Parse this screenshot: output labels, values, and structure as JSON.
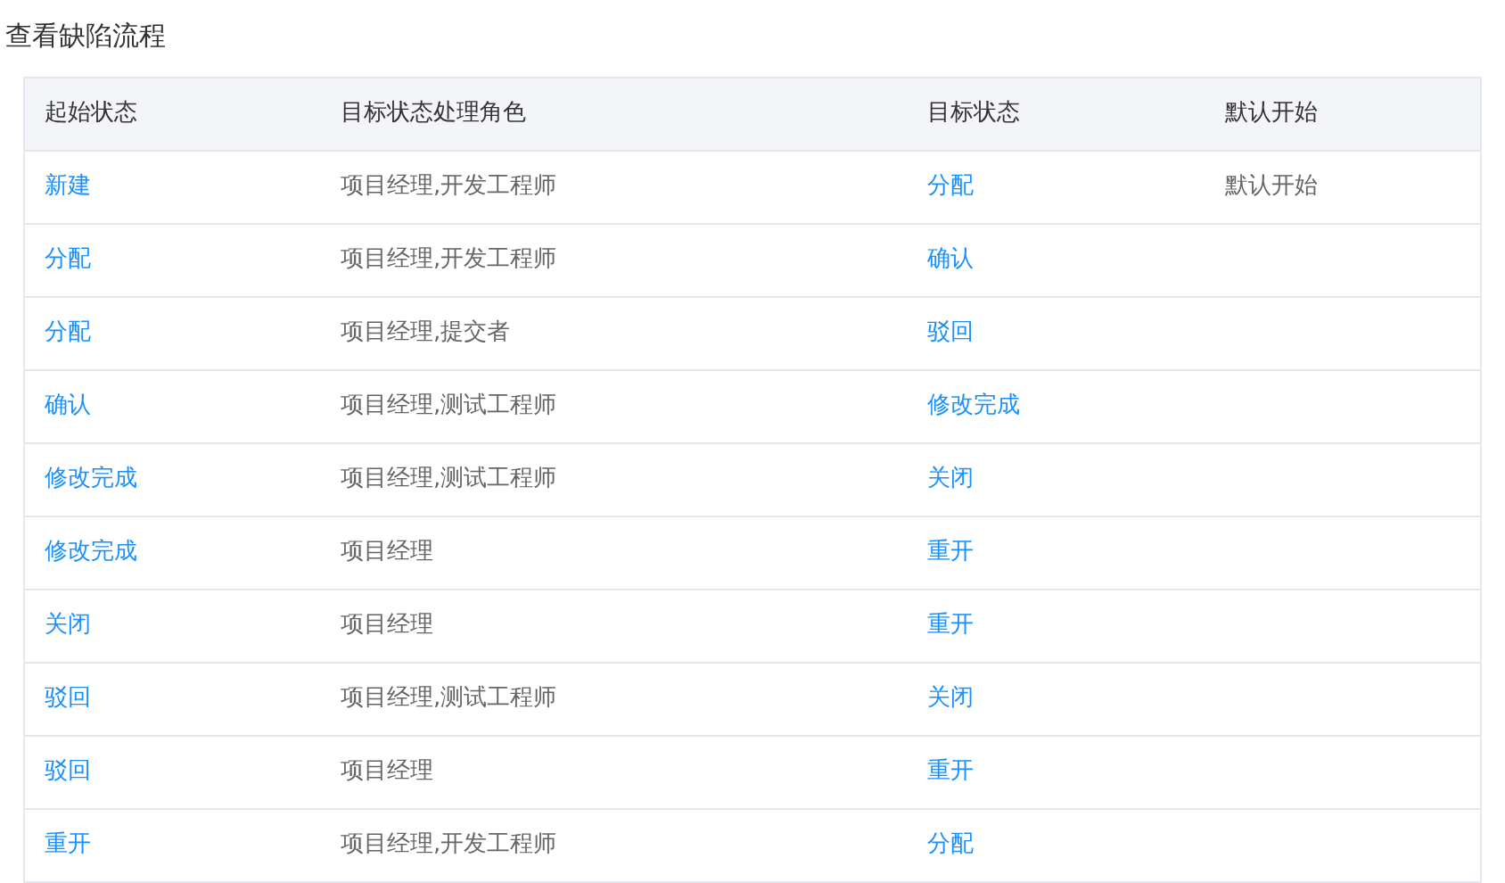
{
  "title": "查看缺陷流程",
  "table": {
    "columns": [
      "起始状态",
      "目标状态处理角色",
      "目标状态",
      "默认开始"
    ],
    "rows": [
      {
        "from": "新建",
        "roles": "项目经理,开发工程师",
        "to": "分配",
        "default": "默认开始"
      },
      {
        "from": "分配",
        "roles": "项目经理,开发工程师",
        "to": "确认"
      },
      {
        "from": "分配",
        "roles": "项目经理,提交者",
        "to": "驳回"
      },
      {
        "from": "确认",
        "roles": "项目经理,测试工程师",
        "to": "修改完成"
      },
      {
        "from": "修改完成",
        "roles": "项目经理,测试工程师",
        "to": "关闭"
      },
      {
        "from": "修改完成",
        "roles": "项目经理",
        "to": "重开"
      },
      {
        "from": "关闭",
        "roles": "项目经理",
        "to": "重开"
      },
      {
        "from": "驳回",
        "roles": "项目经理,测试工程师",
        "to": "关闭"
      },
      {
        "from": "驳回",
        "roles": "项目经理",
        "to": "重开"
      },
      {
        "from": "重开",
        "roles": "项目经理,开发工程师",
        "to": "分配"
      }
    ]
  }
}
